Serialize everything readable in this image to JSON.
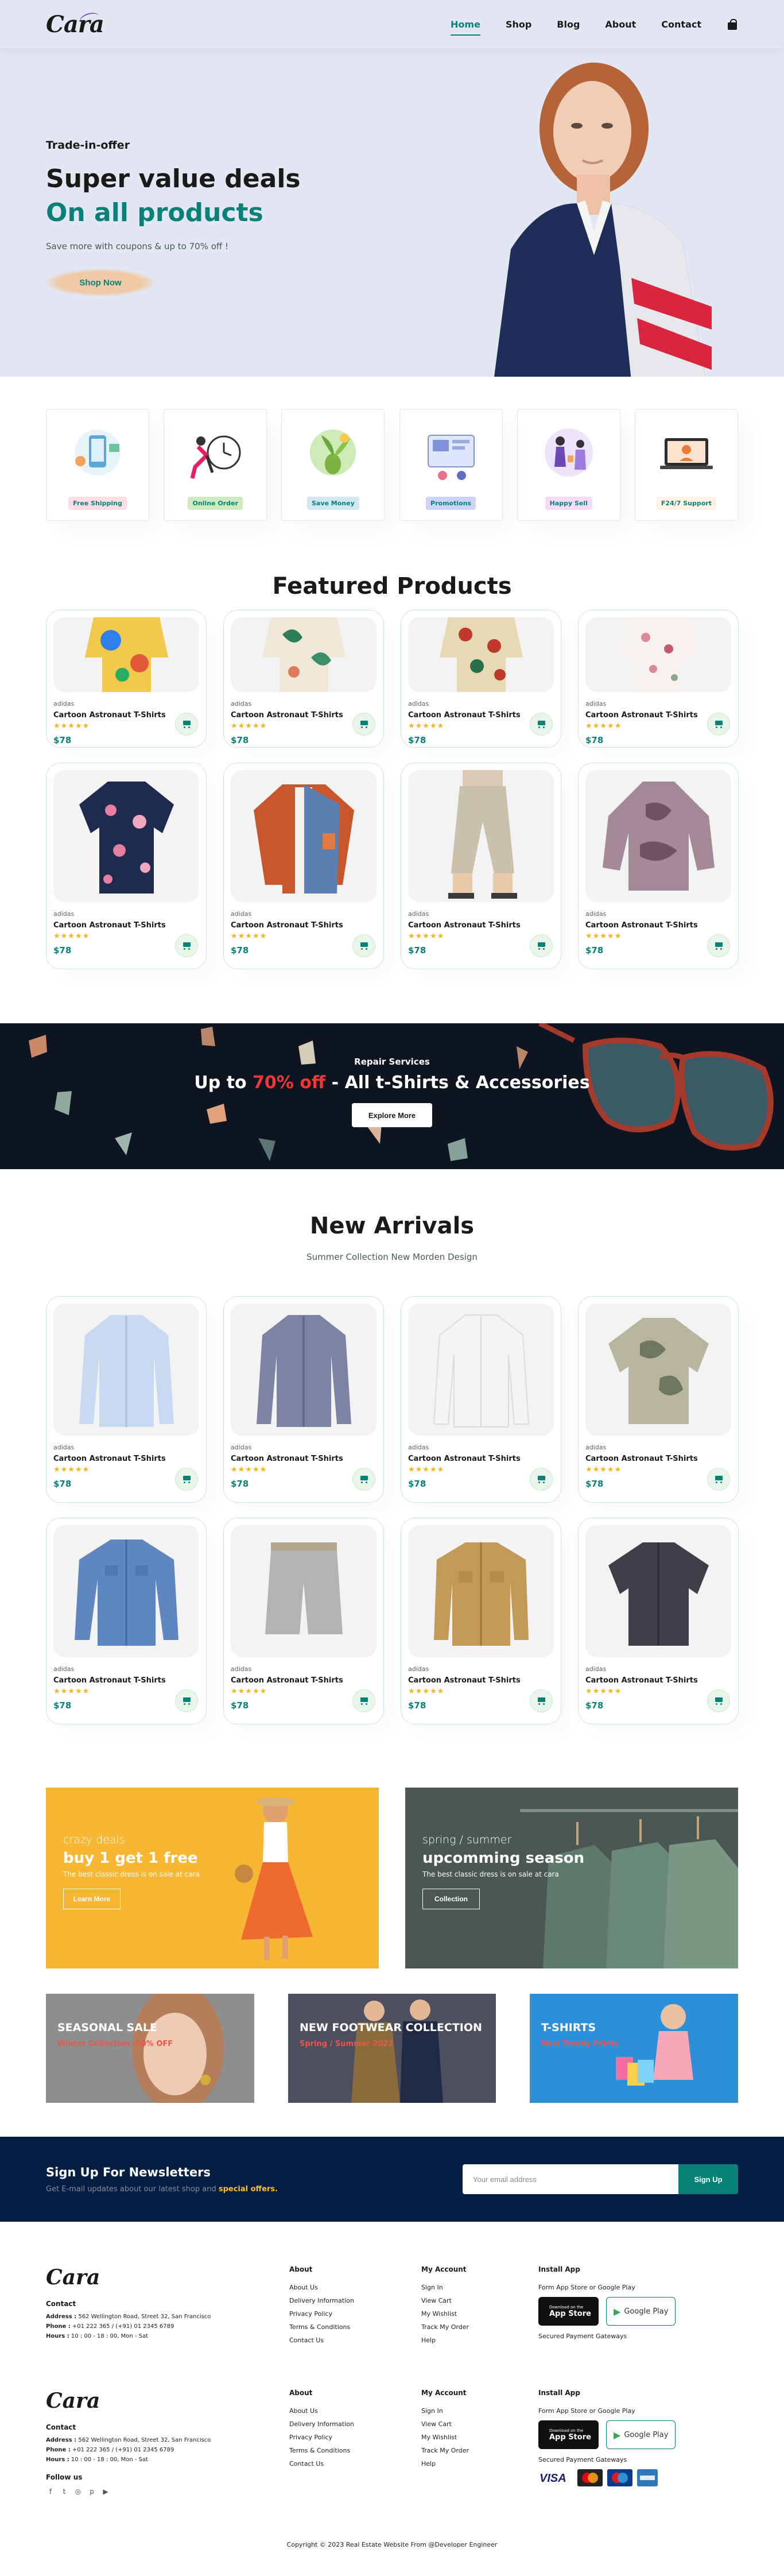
{
  "header": {
    "logo": "Cara",
    "nav": [
      "Home",
      "Shop",
      "Blog",
      "About",
      "Contact"
    ]
  },
  "hero": {
    "kicker": "Trade-in-offer",
    "title": "Super value deals",
    "highlight": "On all products",
    "subtitle": "Save more with coupons & up to 70% off !",
    "button": "Shop Now"
  },
  "features": [
    {
      "label": "Free Shipping",
      "color": "#fddde4"
    },
    {
      "label": "Online Order",
      "color": "#cdebbc"
    },
    {
      "label": "Save Money",
      "color": "#d1e8f2"
    },
    {
      "label": "Promotions",
      "color": "#cdd4f8"
    },
    {
      "label": "Happy Sell",
      "color": "#f6dbf6"
    },
    {
      "label": "F24/7 Support",
      "color": "#fff2e5"
    }
  ],
  "featured": {
    "title": "Featured Products",
    "products": [
      {
        "brand": "adidas",
        "name": "Cartoon Astronaut T-Shirts",
        "stars": "★★★★★",
        "price": "$78"
      },
      {
        "brand": "adidas",
        "name": "Cartoon Astronaut T-Shirts",
        "stars": "★★★★★",
        "price": "$78"
      },
      {
        "brand": "adidas",
        "name": "Cartoon Astronaut T-Shirts",
        "stars": "★★★★★",
        "price": "$78"
      },
      {
        "brand": "adidas",
        "name": "Cartoon Astronaut T-Shirts",
        "stars": "★★★★★",
        "price": "$78"
      },
      {
        "brand": "adidas",
        "name": "Cartoon Astronaut T-Shirts",
        "stars": "★★★★★",
        "price": "$78"
      },
      {
        "brand": "adidas",
        "name": "Cartoon Astronaut T-Shirts",
        "stars": "★★★★★",
        "price": "$78"
      },
      {
        "brand": "adidas",
        "name": "Cartoon Astronaut T-Shirts",
        "stars": "★★★★★",
        "price": "$78"
      },
      {
        "brand": "adidas",
        "name": "Cartoon Astronaut T-Shirts",
        "stars": "★★★★★",
        "price": "$78"
      }
    ]
  },
  "repair": {
    "kicker": "Repair Services",
    "title_pre": "Up to ",
    "title_red": "70% off",
    "title_post": " - All t-Shirts & Accessories",
    "button": "Explore More"
  },
  "arrivals": {
    "title": "New Arrivals",
    "subtitle": "Summer Collection New Morden Design",
    "products": [
      {
        "brand": "adidas",
        "name": "Cartoon Astronaut T-Shirts",
        "stars": "★★★★★",
        "price": "$78"
      },
      {
        "brand": "adidas",
        "name": "Cartoon Astronaut T-Shirts",
        "stars": "★★★★★",
        "price": "$78"
      },
      {
        "brand": "adidas",
        "name": "Cartoon Astronaut T-Shirts",
        "stars": "★★★★★",
        "price": "$78"
      },
      {
        "brand": "adidas",
        "name": "Cartoon Astronaut T-Shirts",
        "stars": "★★★★★",
        "price": "$78"
      },
      {
        "brand": "adidas",
        "name": "Cartoon Astronaut T-Shirts",
        "stars": "★★★★★",
        "price": "$78"
      },
      {
        "brand": "adidas",
        "name": "Cartoon Astronaut T-Shirts",
        "stars": "★★★★★",
        "price": "$78"
      },
      {
        "brand": "adidas",
        "name": "Cartoon Astronaut T-Shirts",
        "stars": "★★★★★",
        "price": "$78"
      },
      {
        "brand": "adidas",
        "name": "Cartoon Astronaut T-Shirts",
        "stars": "★★★★★",
        "price": "$78"
      }
    ]
  },
  "promo": {
    "left": {
      "kicker": "crazy deals",
      "title": "buy 1 get 1 free",
      "text": "The best classic dress is on sale at cara",
      "button": "Learn More"
    },
    "right": {
      "kicker": "spring / summer",
      "title": "upcomming season",
      "text": "The best classic dress is on sale at cara",
      "button": "Collection"
    }
  },
  "banners3": [
    {
      "title": "SEASONAL SALE",
      "sub": "Winter Collection -50% OFF"
    },
    {
      "title": "NEW FOOTWEAR COLLECTION",
      "sub": "Spring / Summer 2022"
    },
    {
      "title": "T-SHIRTS",
      "sub": "New Trendy Prints"
    }
  ],
  "newsletter": {
    "title": "Sign Up For Newsletters",
    "text_pre": "Get E-mail updates about our latest shop and ",
    "text_highlight": "special offers.",
    "placeholder": "Your email address",
    "button": "Sign Up"
  },
  "footer": {
    "logo": "Cara",
    "contact_title": "Contact",
    "address_label": "Address :",
    "address": " 562 Wellington Road, Street 32, San Francisco",
    "phone_label": "Phone :",
    "phone": " +01 222 365 / (+91) 01 2345 6789",
    "hours_label": "Hours :",
    "hours": " 10 : 00 - 18 : 00, Mon - Sat",
    "follow": "Follow us",
    "about_title": "About",
    "about_links": [
      "About Us",
      "Delivery Information",
      "Privacy Policy",
      "Terms & Conditions",
      "Contact Us"
    ],
    "account_title": "My Account",
    "account_links": [
      "Sign In",
      "View Cart",
      "My Wishlist",
      "Track My Order",
      "Help"
    ],
    "app_title": "Install App",
    "app_text": "Form App Store or Google Play",
    "appstore_small": "Download on the",
    "appstore_big": "App Store",
    "google_big": "Google Play",
    "secured": "Secured Payment Gateways",
    "copyright": "Copyright © 2023 Real Estate Website From @Developer Engineer"
  }
}
